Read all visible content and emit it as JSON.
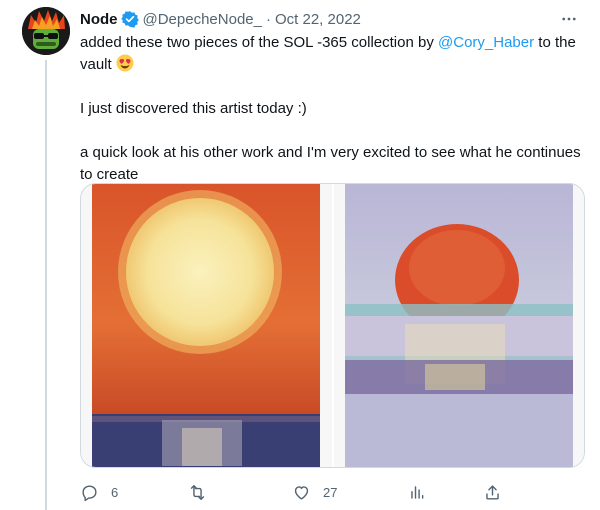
{
  "tweet": {
    "display_name": "Node",
    "handle": "@DepecheNode_",
    "separator": "·",
    "timestamp": "Oct 22, 2022",
    "text": {
      "line1_before": "added these two pieces of the SOL -365 collection by",
      "mention": "@Cory_Haber",
      "line1_after": "to the vault",
      "line2": "I just discovered this artist today :)",
      "line3": "a quick look at his other work and I'm very excited to see what he continues to create"
    },
    "emoji": "heart-eyes-emoji",
    "media": [
      "sun-painting-orange",
      "sun-painting-sunset"
    ],
    "actions": {
      "reply_count": "6",
      "retweet_count": "",
      "like_count": "27",
      "views_count": ""
    }
  },
  "colors": {
    "accent": "#1d9bf0",
    "text": "#0f1419",
    "muted": "#536471",
    "border": "#cfd9de"
  }
}
